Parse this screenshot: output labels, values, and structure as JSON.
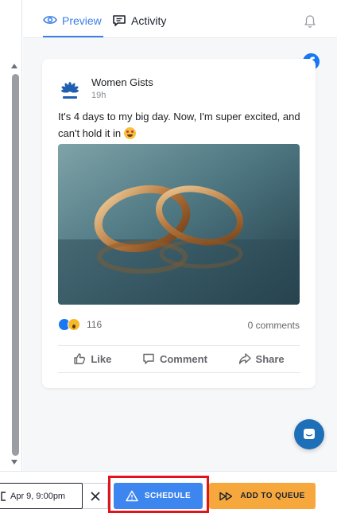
{
  "tabs": {
    "preview_label": "Preview",
    "activity_label": "Activity"
  },
  "post": {
    "network_icon": "facebook-icon",
    "author": "Women Gists",
    "time": "19h",
    "text": "It's 4 days to my big day. Now, I'm super excited, and can't hold it in",
    "text_emoji": "star-struck-emoji",
    "image_subject": "two gold wedding rings",
    "reaction_count": "116",
    "comments_label": "0 comments",
    "actions": {
      "like": "Like",
      "comment": "Comment",
      "share": "Share"
    }
  },
  "bottom_bar": {
    "date_value": "Apr 9, 9:00pm",
    "schedule_label": "SCHEDULE",
    "queue_label": "ADD TO QUEUE"
  },
  "colors": {
    "accent_blue": "#3b7fe6",
    "schedule_button": "#3d86f0",
    "queue_button": "#f7a83d",
    "highlight_border": "#e0151b",
    "facebook_blue": "#1877f2"
  }
}
